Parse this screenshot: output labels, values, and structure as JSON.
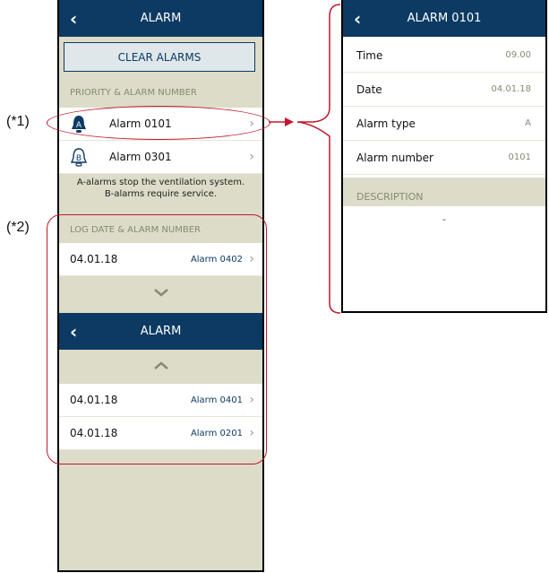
{
  "left_screen": {
    "title": "ALARM",
    "clear_button": "CLEAR ALARMS",
    "priority_section": "PRIORITY & ALARM NUMBER",
    "alarms": [
      {
        "badge": "A",
        "label": "Alarm 0101"
      },
      {
        "badge": "B",
        "label": "Alarm 0301"
      }
    ],
    "info_line1": "A-alarms stop the ventilation system.",
    "info_line2": "B-alarms require service.",
    "log_section": "LOG DATE & ALARM NUMBER",
    "log_rows": [
      {
        "date": "04.01.18",
        "alarm": "Alarm 0402"
      }
    ]
  },
  "left_screen_2": {
    "title": "ALARM",
    "log_rows": [
      {
        "date": "04.01.18",
        "alarm": "Alarm 0401"
      },
      {
        "date": "04.01.18",
        "alarm": "Alarm 0201"
      }
    ]
  },
  "right_screen": {
    "title": "ALARM 0101",
    "rows": [
      {
        "label": "Time",
        "value": "09.00"
      },
      {
        "label": "Date",
        "value": "04.01.18"
      },
      {
        "label": "Alarm type",
        "value": "A"
      },
      {
        "label": "Alarm number",
        "value": "0101"
      }
    ],
    "description_label": "DESCRIPTION",
    "description_value": "-"
  },
  "annotations": {
    "a1": "(*1)",
    "a2": "(*2)"
  },
  "colors": {
    "header": "#0c3a62",
    "highlight": "#c0182c",
    "panel_bg": "#dcdcc8"
  }
}
